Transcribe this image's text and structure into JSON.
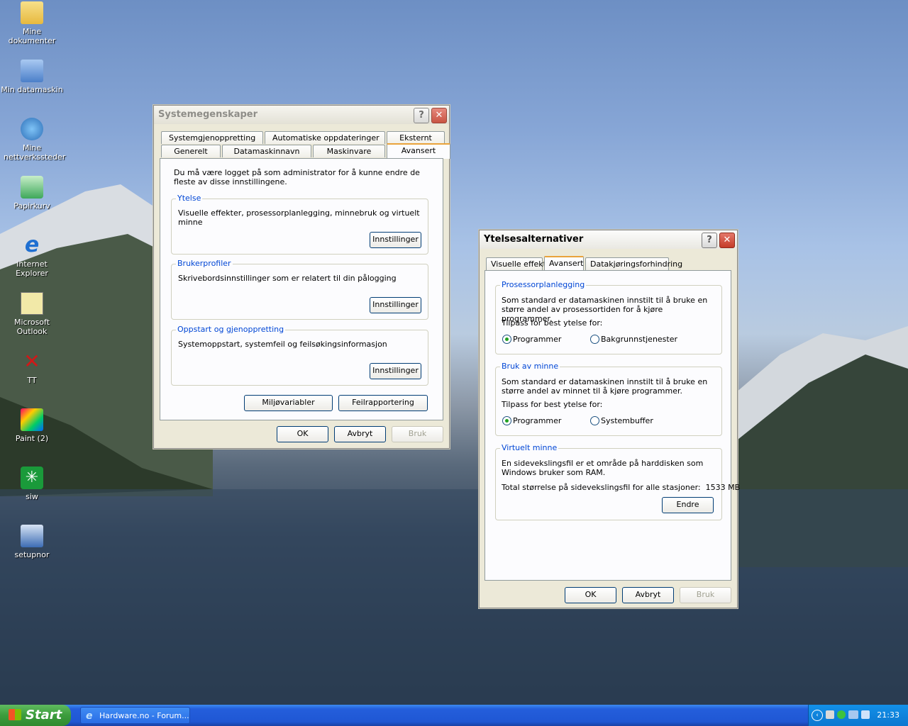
{
  "desktop": {
    "icons": [
      {
        "label": "Mine dokumenter"
      },
      {
        "label": "Min datamaskin"
      },
      {
        "label": "Mine nettverkssteder"
      },
      {
        "label": "Papirkurv"
      },
      {
        "label": "Internet Explorer"
      },
      {
        "label": "Microsoft Outlook"
      },
      {
        "label": "TT"
      },
      {
        "label": "Paint (2)"
      },
      {
        "label": "siw"
      },
      {
        "label": "setupnor"
      }
    ]
  },
  "sysprops": {
    "title": "Systemegenskaper",
    "help": "?",
    "close": "✕",
    "tabs_top": [
      "Systemgjenoppretting",
      "Automatiske oppdateringer",
      "Eksternt"
    ],
    "tabs_bottom": [
      "Generelt",
      "Datamaskinnavn",
      "Maskinvare",
      "Avansert"
    ],
    "intro": "Du må være logget på som administrator for å kunne endre de fleste av disse innstillingene.",
    "groups": [
      {
        "legend": "Ytelse",
        "text": "Visuelle effekter, prosessorplanlegging, minnebruk og virtuelt minne",
        "button": "Innstillinger"
      },
      {
        "legend": "Brukerprofiler",
        "text": "Skrivebordsinnstillinger som er relatert til din pålogging",
        "button": "Innstillinger"
      },
      {
        "legend": "Oppstart og gjenoppretting",
        "text": "Systemoppstart, systemfeil og feilsøkingsinformasjon",
        "button": "Innstillinger"
      }
    ],
    "env_button": "Miljøvariabler",
    "error_button": "Feilrapportering",
    "ok": "OK",
    "cancel": "Avbryt",
    "apply": "Bruk"
  },
  "perf": {
    "title": "Ytelsesalternativer",
    "help": "?",
    "close": "✕",
    "tabs": [
      "Visuelle effekter",
      "Avansert",
      "Datakjøringsforhindring"
    ],
    "cpu": {
      "legend": "Prosessorplanlegging",
      "text": "Som standard er datamaskinen innstilt til å bruke en større andel av prosessortiden for å kjøre programmer.",
      "adjust": "Tilpass for best ytelse for:",
      "opt1": "Programmer",
      "opt2": "Bakgrunnstjenester"
    },
    "mem": {
      "legend": "Bruk av minne",
      "text": "Som standard er datamaskinen innstilt til å bruke en større andel av minnet til å kjøre programmer.",
      "adjust": "Tilpass for best ytelse for:",
      "opt1": "Programmer",
      "opt2": "Systembuffer"
    },
    "vm": {
      "legend": "Virtuelt minne",
      "text": "En sidevekslingsfil er et område på harddisken som Windows bruker som RAM.",
      "total": "Total størrelse på sidevekslingsfil for alle stasjoner:  1533 MB",
      "button": "Endre"
    },
    "ok": "OK",
    "cancel": "Avbryt",
    "apply": "Bruk"
  },
  "taskbar": {
    "start": "Start",
    "task": "Hardware.no - Forum...",
    "clock": "21:33"
  }
}
